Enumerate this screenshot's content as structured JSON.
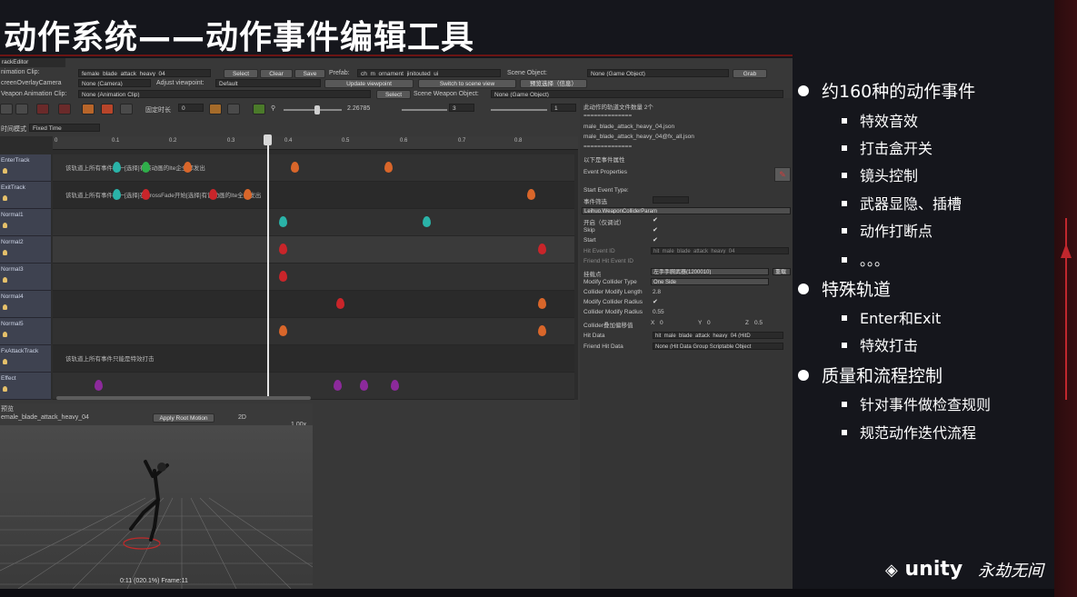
{
  "slide": {
    "title": "动作系统——动作事件编辑工具"
  },
  "editor": {
    "tab_title": "rackEditor",
    "rows": {
      "animation_clip_label": "nimation Clip:",
      "animation_clip_value": "female_blade_attack_heavy_04",
      "select_btn": "Select",
      "clear_btn": "Clear",
      "save_btn": "Save",
      "prefab_label": "Prefab:",
      "prefab_value": "ch_m_ornament_jinitouted_ui",
      "scene_object_label": "Scene Object:",
      "scene_object_value": "None (Game Object)",
      "grab_btn": "Grab",
      "camera_label": "creenOverlayCamera",
      "camera_value": "None (Camera)",
      "adjust_label": "Adjust viewpoint:",
      "adjust_value": "Default",
      "update_viewpoint_btn": "Update viewpoint",
      "switch_scene_btn": "Switch to scene view",
      "preview_btn": "预览选择（信息）",
      "weapon_clip_label": "Veapon Animation Clip:",
      "weapon_clip_value": "None (Animation Clip)",
      "select_btn2": "Select",
      "scene_weapon_label": "Scene Weapon Object:",
      "scene_weapon_value": "None (Game Object)"
    },
    "toolbar": {
      "fixed_label": "固定时长",
      "fixed_value": "0",
      "zoom_value": "2.26785",
      "count_value": "3",
      "end_value": "1",
      "time_mode_label": "时间模式",
      "time_mode_value": "Fixed Time"
    },
    "ruler_ticks": [
      "0",
      "0.1",
      "0.2",
      "0.3",
      "0.4",
      "0.5",
      "0.6",
      "0.7",
      "0.8"
    ],
    "tracks": [
      {
        "label": "EnterTrack",
        "note": "该轨道上所有事件在一[选择]有该动画的Ite企全部发出"
      },
      {
        "label": "ExitTrack",
        "note": "该轨道上所有事件在一[选择]在CrossFade开始[选择]有该动画的Ite全部发出"
      },
      {
        "label": "Normal1",
        "note": ""
      },
      {
        "label": "Normal2",
        "note": ""
      },
      {
        "label": "Normal3",
        "note": ""
      },
      {
        "label": "Normal4",
        "note": ""
      },
      {
        "label": "Normal5",
        "note": ""
      },
      {
        "label": "FxAttackTrack",
        "note": "该轨道上所有事件只能是特效打击"
      },
      {
        "label": "Effect",
        "note": ""
      }
    ],
    "marker_colors": {
      "orange": "#d9662a",
      "teal": "#2ab3a8",
      "green": "#2fae4a",
      "red": "#c9252a",
      "purple": "#8c2a9b"
    },
    "props": {
      "header1": "此动作的轨道文件数量 2个",
      "sep1": "==============",
      "file1": "male_blade_attack_heavy_04.json",
      "file2": "male_blade_attack_heavy_04@fx_all.json",
      "sep2": "==============",
      "section": "以下是事件属性",
      "event_properties": "Event Properties",
      "start_event_type": "Start Event Type:",
      "event_filter": "事件筛选",
      "event_type_value": "Leihuo.WeaponColliderParam",
      "open_label": "开启（仅调试）",
      "skip_label": "Skip",
      "start_label": "Start",
      "hit_event_id_label": "Hit Event ID",
      "hit_event_id_value": "hit_male_blade_attack_heavy_04",
      "friend_hit_event_id": "Friend Hit Event ID",
      "attach_point_label": "挂载点",
      "attach_point_value": "左手手腕武器(1200010)",
      "reset_btn": "重载",
      "modify_collider_type": "Modify Collider Type",
      "modify_collider_type_value": "One Side",
      "collider_modify_length": "Collider Modify Length",
      "collider_modify_length_value": "2.8",
      "modify_collider_radius": "Modify Collider Radius",
      "collider_modify_radius": "Collider Modify Radius",
      "collider_modify_radius_value": "0.55",
      "collider_offset_label": "Collider叠加偏移值",
      "offset_x": "0",
      "offset_y": "0",
      "offset_z": "0.5",
      "hit_data_label": "Hit Data",
      "hit_data_value": "hit_male_blade_attack_heavy_04 (HitD",
      "friend_hit_data_label": "Friend Hit Data",
      "friend_hit_data_value": "None (Hit Data Group Scriptable Object"
    },
    "preview": {
      "label": "预览",
      "clip": "emale_blade_attack_heavy_04",
      "apply_root_motion": "Apply Root Motion",
      "mode_2d": "2D",
      "speed": "1.00x",
      "timestamp": "0:11 (020.1%) Frame:11"
    }
  },
  "bullets": [
    {
      "level": 1,
      "text": "约160种的动作事件"
    },
    {
      "level": 2,
      "text": "特效音效"
    },
    {
      "level": 2,
      "text": "打击盒开关"
    },
    {
      "level": 2,
      "text": "镜头控制"
    },
    {
      "level": 2,
      "text": "武器显隐、插槽"
    },
    {
      "level": 2,
      "text": "动作打断点"
    },
    {
      "level": 2,
      "text": "。。。"
    },
    {
      "level": 1,
      "text": "特殊轨道"
    },
    {
      "level": 2,
      "text": "Enter和Exit"
    },
    {
      "level": 2,
      "text": "特效打击"
    },
    {
      "level": 1,
      "text": "质量和流程控制"
    },
    {
      "level": 2,
      "text": "针对事件做检查规则"
    },
    {
      "level": 2,
      "text": "规范动作迭代流程"
    }
  ],
  "logos": {
    "unity": "unity",
    "game": "永劫无间"
  }
}
